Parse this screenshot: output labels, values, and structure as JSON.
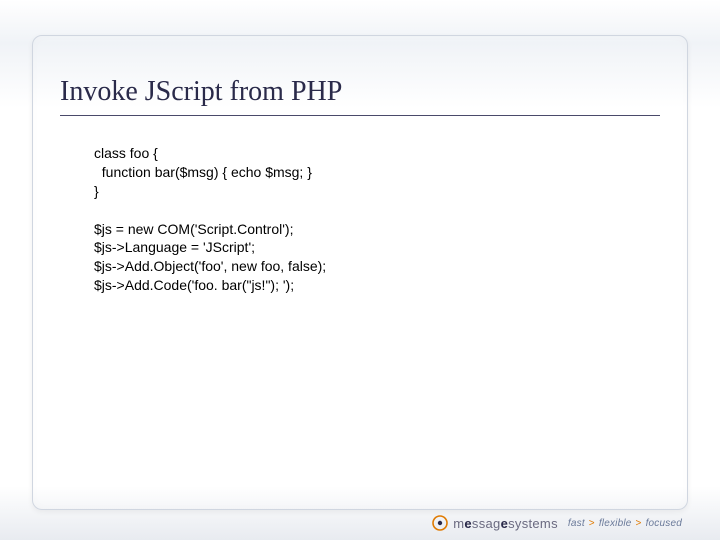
{
  "heading": "Invoke JScript from PHP",
  "code": "class foo {\n  function bar($msg) { echo $msg; }\n}\n\n$js = new COM('Script.Control');\n$js->Language = 'JScript';\n$js->Add.Object('foo', new foo, false);\n$js->Add.Code('foo. bar(\"js!\"); ');",
  "footer": {
    "logo_light": "m",
    "logo_bold_1": "e",
    "logo_light_2": "ssag",
    "logo_bold_2": "e",
    "logo_light_3": "systems",
    "tag1": "fast",
    "tag2": "flexible",
    "tag3": "focused"
  }
}
